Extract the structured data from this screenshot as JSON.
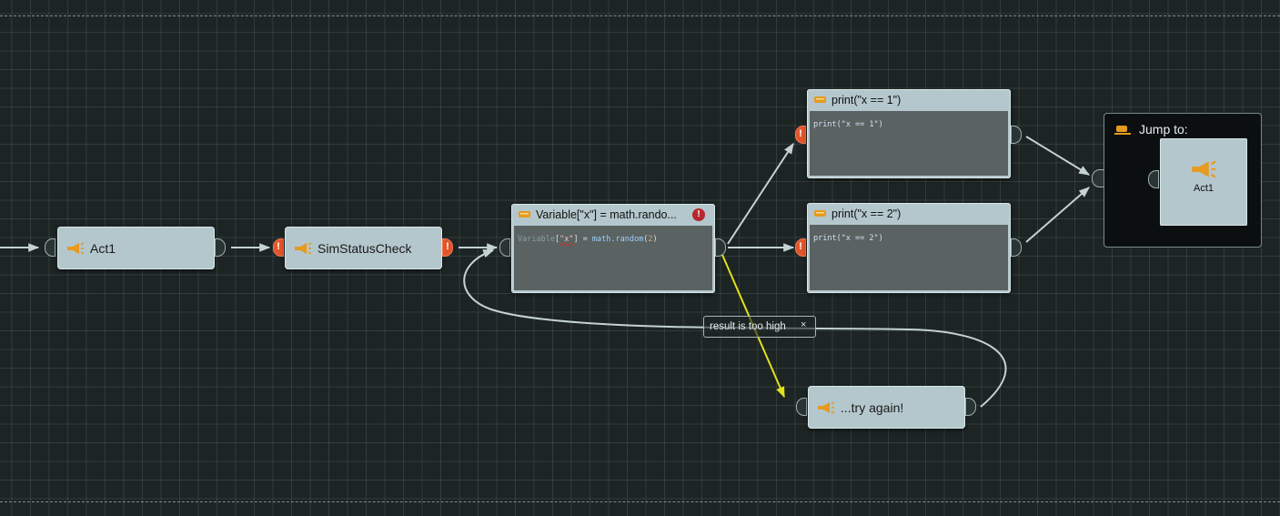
{
  "nodes": {
    "act1": {
      "label": "Act1"
    },
    "sim_status": {
      "label": "SimStatusCheck"
    },
    "variable": {
      "title": "Variable[\"x\"] = math.rando...",
      "code_var": "Variable",
      "code_br1": "[",
      "code_key": "\"x\"",
      "code_rest": "] = ",
      "code_fn": "math.random",
      "code_arg": "(",
      "code_num": "2",
      "code_end": ")"
    },
    "print1": {
      "title": "print(\"x == 1\")",
      "code": "print(\"x == 1\")"
    },
    "print2": {
      "title": "print(\"x == 2\")",
      "code": "print(\"x == 2\")"
    },
    "try_again": {
      "label": "...try again!"
    },
    "jump": {
      "title": "Jump to:",
      "target": "Act1"
    }
  },
  "condition": {
    "label": "result is too high",
    "close": "×"
  },
  "error_mark": "!",
  "warning_mark": "!",
  "colors": {
    "background": "#1c2424",
    "node": "#b4c7cc",
    "link": "#c4d2d4",
    "conditional_link": "#e2e21a",
    "error_port": "#e2552a"
  }
}
